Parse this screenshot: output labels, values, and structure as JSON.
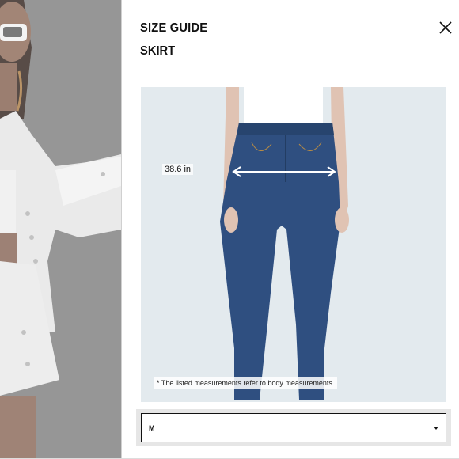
{
  "panel": {
    "title": "SIZE GUIDE",
    "subtitle": "SKIRT",
    "close_icon": "close-icon"
  },
  "model_image": {
    "measurement_label": "38.6 in",
    "note": "* The listed measurements refer to body measurements."
  },
  "size_select": {
    "selected": "M",
    "caret_icon": "caret-down-icon"
  },
  "colors": {
    "denim": "#2f4f80",
    "background": "#e4ebef",
    "text": "#111111"
  }
}
